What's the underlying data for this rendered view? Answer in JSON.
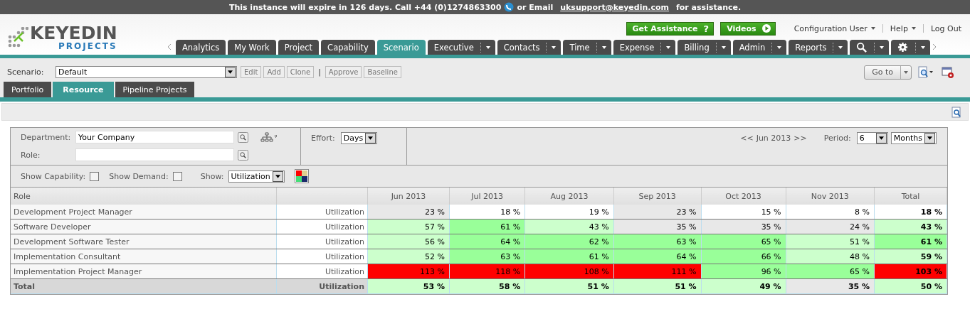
{
  "banner": {
    "text": "This instance will expire in 126 days.  Call +44 (0)1274863300",
    "email_prefix": "or Email",
    "email": "uksupport@keyedin.com",
    "suffix": "for assistance."
  },
  "logo": {
    "name": "KEYEDIN",
    "sub": "PROJECTS"
  },
  "top_buttons": [
    {
      "label": "Get Assistance",
      "kind": "help",
      "icon": "?"
    },
    {
      "label": "Videos",
      "kind": "play"
    }
  ],
  "user_menu": [
    {
      "label": "Configuration User",
      "dropdown": true
    },
    {
      "label": "Help",
      "dropdown": true
    },
    {
      "label": "Log Out",
      "dropdown": false
    }
  ],
  "nav_tabs": [
    {
      "label": "Analytics",
      "kind": "text",
      "selected": false,
      "dropdown": false
    },
    {
      "label": "My Work",
      "kind": "text",
      "selected": false,
      "dropdown": false
    },
    {
      "label": "Project",
      "kind": "text",
      "selected": false,
      "dropdown": false
    },
    {
      "label": "Capability",
      "kind": "text",
      "selected": false,
      "dropdown": false
    },
    {
      "label": "Scenario",
      "kind": "text",
      "selected": true,
      "dropdown": false
    },
    {
      "label": "Executive",
      "kind": "text",
      "selected": false,
      "dropdown": true
    },
    {
      "label": "Contacts",
      "kind": "text",
      "selected": false,
      "dropdown": true
    },
    {
      "label": "Time",
      "kind": "text",
      "selected": false,
      "dropdown": true
    },
    {
      "label": "Expense",
      "kind": "text",
      "selected": false,
      "dropdown": true
    },
    {
      "label": "Billing",
      "kind": "text",
      "selected": false,
      "dropdown": true
    },
    {
      "label": "Admin",
      "kind": "text",
      "selected": false,
      "dropdown": true
    },
    {
      "label": "Reports",
      "kind": "text",
      "selected": false,
      "dropdown": true
    },
    {
      "kind": "search",
      "selected": false,
      "dropdown": true
    },
    {
      "kind": "settings",
      "selected": false,
      "dropdown": true
    }
  ],
  "scenario": {
    "label": "Scenario:",
    "value": "Default",
    "buttons": [
      "Edit",
      "Add",
      "Clone"
    ],
    "separator": "|",
    "buttons2": [
      "Approve",
      "Baseline"
    ],
    "goto": "Go to"
  },
  "sub_tabs": [
    {
      "label": "Portfolio",
      "selected": false
    },
    {
      "label": "Resource",
      "selected": true
    },
    {
      "label": "Pipeline Projects",
      "selected": false
    }
  ],
  "filters": {
    "department_label": "Department:",
    "department": "Your Company",
    "role_label": "Role:",
    "effort_label": "Effort:",
    "effort": "Days",
    "prev": "<<",
    "period_date": "Jun 2013",
    "next": ">>",
    "period_label": "Period:",
    "period": "6",
    "unit": "Months",
    "show_capability_label": "Show Capability:",
    "show_capability": false,
    "show_demand_label": "Show Demand:",
    "show_demand": false,
    "show_label": "Show:",
    "show": "Utilization"
  },
  "table": {
    "columns": [
      "Role",
      "",
      "Jun 2013",
      "Jul 2013",
      "Aug 2013",
      "Sep 2013",
      "Oct 2013",
      "Nov 2013",
      "Total"
    ],
    "rows": [
      {
        "cells": [
          {
            "value": "Development Project Manager"
          },
          {
            "value": "Utilization"
          },
          {
            "value": "23 %",
            "color": "#e8e8e8"
          },
          {
            "value": "18 %",
            "color": "#ffffff"
          },
          {
            "value": "19 %",
            "color": "#ffffff"
          },
          {
            "value": "23 %",
            "color": "#e8e8e8"
          },
          {
            "value": "15 %",
            "color": "#ffffff"
          },
          {
            "value": "8 %",
            "color": "#ffffff"
          },
          {
            "value": "18 %",
            "color": "#ffffff"
          }
        ],
        "total": false
      },
      {
        "cells": [
          {
            "value": "Software Developer"
          },
          {
            "value": "Utilization"
          },
          {
            "value": "57 %",
            "color": "#ccffcc"
          },
          {
            "value": "61 %",
            "color": "#99ff99"
          },
          {
            "value": "43 %",
            "color": "#ccffcc"
          },
          {
            "value": "35 %",
            "color": "#e8e8e8"
          },
          {
            "value": "35 %",
            "color": "#e8e8e8"
          },
          {
            "value": "24 %",
            "color": "#e8e8e8"
          },
          {
            "value": "43 %",
            "color": "#ccffcc"
          }
        ],
        "total": false
      },
      {
        "cells": [
          {
            "value": "Development Software Tester"
          },
          {
            "value": "Utilization"
          },
          {
            "value": "56 %",
            "color": "#ccffcc"
          },
          {
            "value": "64 %",
            "color": "#99ff99"
          },
          {
            "value": "62 %",
            "color": "#99ff99"
          },
          {
            "value": "63 %",
            "color": "#99ff99"
          },
          {
            "value": "65 %",
            "color": "#99ff99"
          },
          {
            "value": "51 %",
            "color": "#ccffcc"
          },
          {
            "value": "61 %",
            "color": "#99ff99"
          }
        ],
        "total": false
      },
      {
        "cells": [
          {
            "value": "Implementation Consultant"
          },
          {
            "value": "Utilization"
          },
          {
            "value": "52 %",
            "color": "#ccffcc"
          },
          {
            "value": "63 %",
            "color": "#99ff99"
          },
          {
            "value": "61 %",
            "color": "#99ff99"
          },
          {
            "value": "64 %",
            "color": "#99ff99"
          },
          {
            "value": "66 %",
            "color": "#99ff99"
          },
          {
            "value": "48 %",
            "color": "#ccffcc"
          },
          {
            "value": "59 %",
            "color": "#ccffcc"
          }
        ],
        "total": false
      },
      {
        "cells": [
          {
            "value": "Implementation Project Manager"
          },
          {
            "value": "Utilization"
          },
          {
            "value": "113 %",
            "color": "#ff0000"
          },
          {
            "value": "118 %",
            "color": "#ff0000"
          },
          {
            "value": "108 %",
            "color": "#ff0000"
          },
          {
            "value": "111 %",
            "color": "#ff0000"
          },
          {
            "value": "96 %",
            "color": "#99ff99"
          },
          {
            "value": "65 %",
            "color": "#99ff99"
          },
          {
            "value": "103 %",
            "color": "#ff0000"
          }
        ],
        "total": false
      },
      {
        "cells": [
          {
            "value": "Total"
          },
          {
            "value": "Utilization"
          },
          {
            "value": "53 %",
            "color": "#ccffcc"
          },
          {
            "value": "58 %",
            "color": "#ccffcc"
          },
          {
            "value": "51 %",
            "color": "#ccffcc"
          },
          {
            "value": "51 %",
            "color": "#ccffcc"
          },
          {
            "value": "49 %",
            "color": "#ccffcc"
          },
          {
            "value": "35 %",
            "color": "#e8e8e8"
          },
          {
            "value": "50 %",
            "color": "#ccffcc"
          }
        ],
        "total": true
      }
    ]
  }
}
